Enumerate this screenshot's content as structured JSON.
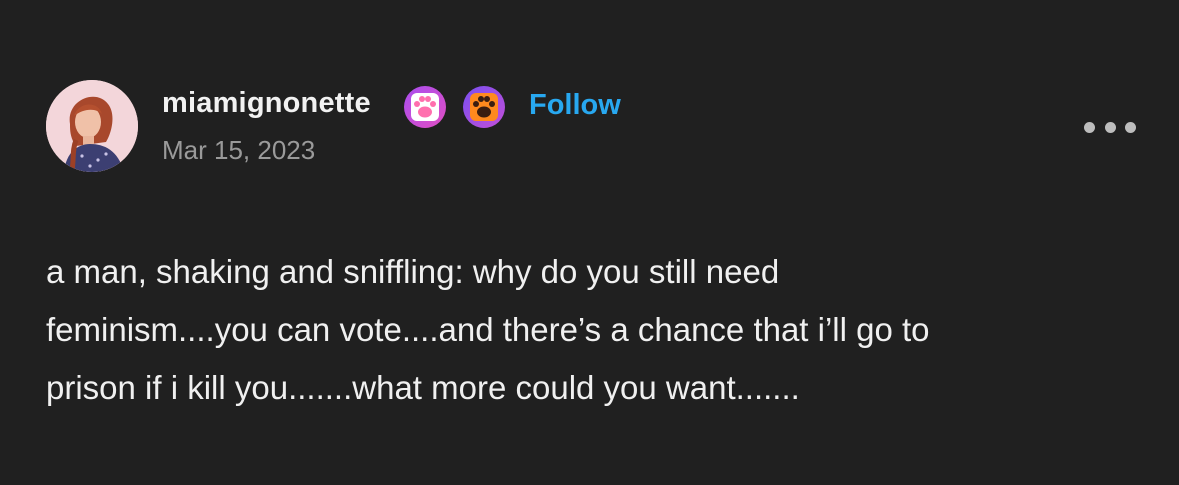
{
  "post": {
    "author": {
      "username": "miamignonette",
      "avatar_icon": "avatar-photo",
      "badges": [
        {
          "icon": "paw-badge-icon",
          "color": "#c73fd8",
          "paw_color": "#ff6fae"
        },
        {
          "icon": "paw-badge-icon",
          "color": "#9b3fd8",
          "paw_color": "#ff8a1e"
        }
      ]
    },
    "follow_label": "Follow",
    "date": "Mar 15, 2023",
    "more_icon": "ellipsis-icon",
    "body_lines": [
      "a man, shaking and sniffling: why do you still need",
      "feminism....you can vote....and there’s a chance that i’ll go to",
      "prison if i kill you.......what more could you want......."
    ]
  },
  "colors": {
    "background": "#202020",
    "text": "#f0f0f0",
    "secondary_text": "#9a9a9a",
    "accent": "#28a8f0"
  }
}
